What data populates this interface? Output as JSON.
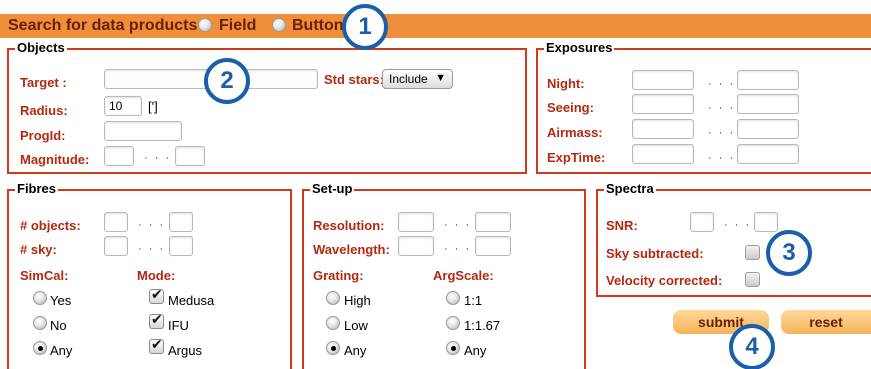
{
  "header": {
    "title": "Search for data products",
    "option_field": "Field",
    "option_button": "Button"
  },
  "callouts": [
    "1",
    "2",
    "3",
    "4"
  ],
  "objects": {
    "legend": "Objects",
    "target_label": "Target :",
    "target_value": "",
    "std_stars_label": "Std stars:",
    "std_stars_value": "Include",
    "radius_label": "Radius:",
    "radius_value": "10",
    "radius_unit": "[']",
    "progid_label": "ProgId:",
    "magnitude_label": "Magnitude:",
    "range_sep": "· · ·"
  },
  "exposures": {
    "legend": "Exposures",
    "night_label": "Night:",
    "seeing_label": "Seeing:",
    "airmass_label": "Airmass:",
    "exptime_label": "ExpTime:",
    "range_sep": "· · ·"
  },
  "fibres": {
    "legend": "Fibres",
    "objects_label": "# objects:",
    "sky_label": "# sky:",
    "simcal_label": "SimCal:",
    "mode_label": "Mode:",
    "simcal_options": [
      "Yes",
      "No",
      "Any"
    ],
    "simcal_selected": "Any",
    "mode_options": [
      "Medusa",
      "IFU",
      "Argus"
    ],
    "range_sep": "· · ·"
  },
  "setup": {
    "legend": "Set-up",
    "resolution_label": "Resolution:",
    "wavelength_label": "Wavelength:",
    "grating_label": "Grating:",
    "argscale_label": "ArgScale:",
    "grating_options": [
      "High",
      "Low",
      "Any"
    ],
    "grating_selected": "Any",
    "argscale_options": [
      "1:1",
      "1:1.67",
      "Any"
    ],
    "argscale_selected": "Any",
    "range_sep": "· · ·"
  },
  "spectra": {
    "legend": "Spectra",
    "snr_label": "SNR:",
    "sky_subtracted_label": "Sky subtracted:",
    "velocity_corrected_label": "Velocity corrected:",
    "range_sep": "· · ·"
  },
  "actions": {
    "submit_label": "submit",
    "reset_label": "reset"
  },
  "colors": {
    "header_bar": "#ee8f3b",
    "box_border": "#cf3b1f",
    "label": "#b52810",
    "callout": "#1b5faa",
    "button": "#f5b45a"
  }
}
